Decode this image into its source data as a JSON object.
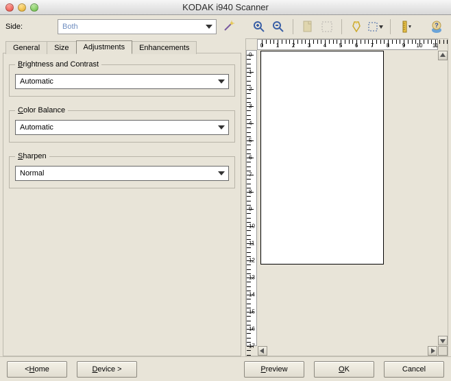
{
  "window": {
    "title": "KODAK i940 Scanner"
  },
  "top": {
    "side_label": "Side:",
    "side_value": "Both"
  },
  "tabs": {
    "general": "General",
    "size": "Size",
    "adjustments": "Adjustments",
    "enhancements": "Enhancements"
  },
  "groups": {
    "brightness": {
      "legend_pre": "B",
      "legend_rest": "rightness and Contrast",
      "value": "Automatic"
    },
    "color": {
      "legend_pre": "C",
      "legend_rest": "olor Balance",
      "value": "Automatic"
    },
    "sharpen": {
      "legend_pre": "S",
      "legend_rest": "harpen",
      "value": "Normal"
    }
  },
  "ruler": {
    "h_labels": [
      "0",
      "1",
      "2",
      "3",
      "4",
      "5",
      "6",
      "7",
      "8",
      "9",
      "10",
      "11"
    ],
    "v_labels": [
      "0",
      "1",
      "2",
      "3",
      "4",
      "5",
      "6",
      "7",
      "8",
      "9",
      "10",
      "11",
      "12",
      "13",
      "14",
      "15",
      "16",
      "17"
    ]
  },
  "buttons": {
    "home_pre": "< ",
    "home_u": "H",
    "home_rest": "ome",
    "device_pre": "",
    "device_u": "D",
    "device_rest": "evice >",
    "preview_pre": "",
    "preview_u": "P",
    "preview_rest": "review",
    "ok_pre": "",
    "ok_u": "O",
    "ok_rest": "K",
    "cancel": "Cancel"
  },
  "icons": {
    "wand": "wand-icon",
    "zoom_in": "zoom-in-icon",
    "zoom_out": "zoom-out-icon",
    "page": "page-icon",
    "marquee": "marquee-icon",
    "highlight": "highlight-icon",
    "tool_dd": "tool-dropdown-icon",
    "measure": "measure-icon",
    "help": "help-icon"
  }
}
